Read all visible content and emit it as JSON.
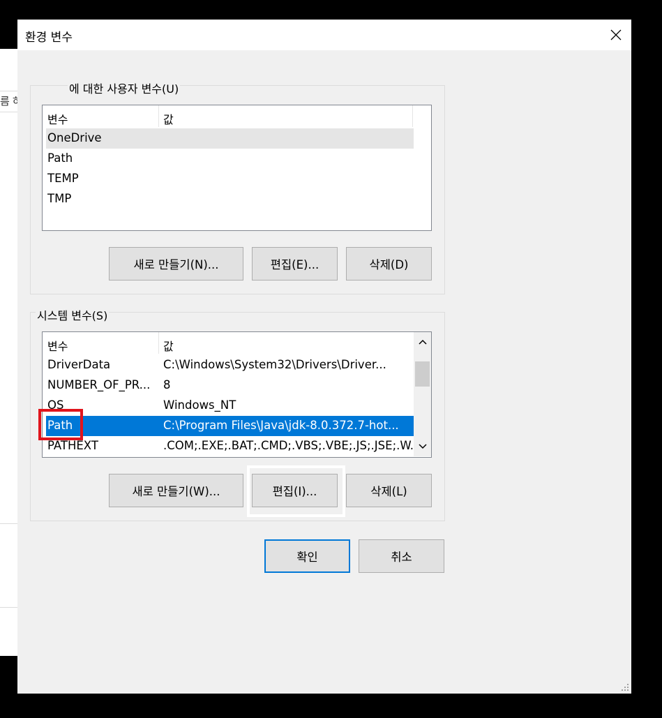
{
  "background_window": {
    "fragments": [
      "름",
      "하"
    ]
  },
  "dialog": {
    "title": "환경 변수",
    "close_icon": "close-icon"
  },
  "user_vars": {
    "legend": "에 대한 사용자 변수(U)",
    "columns": [
      "변수",
      "값"
    ],
    "rows": [
      {
        "name": "OneDrive",
        "value": ""
      },
      {
        "name": "Path",
        "value": ""
      },
      {
        "name": "TEMP",
        "value": ""
      },
      {
        "name": "TMP",
        "value": ""
      }
    ],
    "hovered_row": "OneDrive",
    "buttons": {
      "new": "새로 만들기(N)...",
      "edit": "편집(E)...",
      "delete": "삭제(D)"
    }
  },
  "system_vars": {
    "legend": "시스템 변수(S)",
    "columns": [
      "변수",
      "값"
    ],
    "rows": [
      {
        "name": "DriverData",
        "value": "C:\\Windows\\System32\\Drivers\\Driver..."
      },
      {
        "name": "NUMBER_OF_PR...",
        "value": "8"
      },
      {
        "name": "OS",
        "value": "Windows_NT"
      },
      {
        "name": "Path",
        "value": "C:\\Program Files\\Java\\jdk-8.0.372.7-hot..."
      },
      {
        "name": "PATHEXT",
        "value": ".COM;.EXE;.BAT;.CMD;.VBS;.VBE;.JS;.JSE;.W..."
      }
    ],
    "selected_row": "Path",
    "buttons": {
      "new": "새로 만들기(W)...",
      "edit": "편집(I)...",
      "delete": "삭제(L)"
    },
    "scrollbar": {
      "up_icon": "chevron-up-icon",
      "down_icon": "chevron-down-icon"
    }
  },
  "footer": {
    "ok": "확인",
    "cancel": "취소"
  },
  "colors": {
    "selection": "#0078d7",
    "highlight_red": "#e0141c",
    "highlight_white": "#ffffff",
    "dialog_bg": "#f0f0f0"
  }
}
